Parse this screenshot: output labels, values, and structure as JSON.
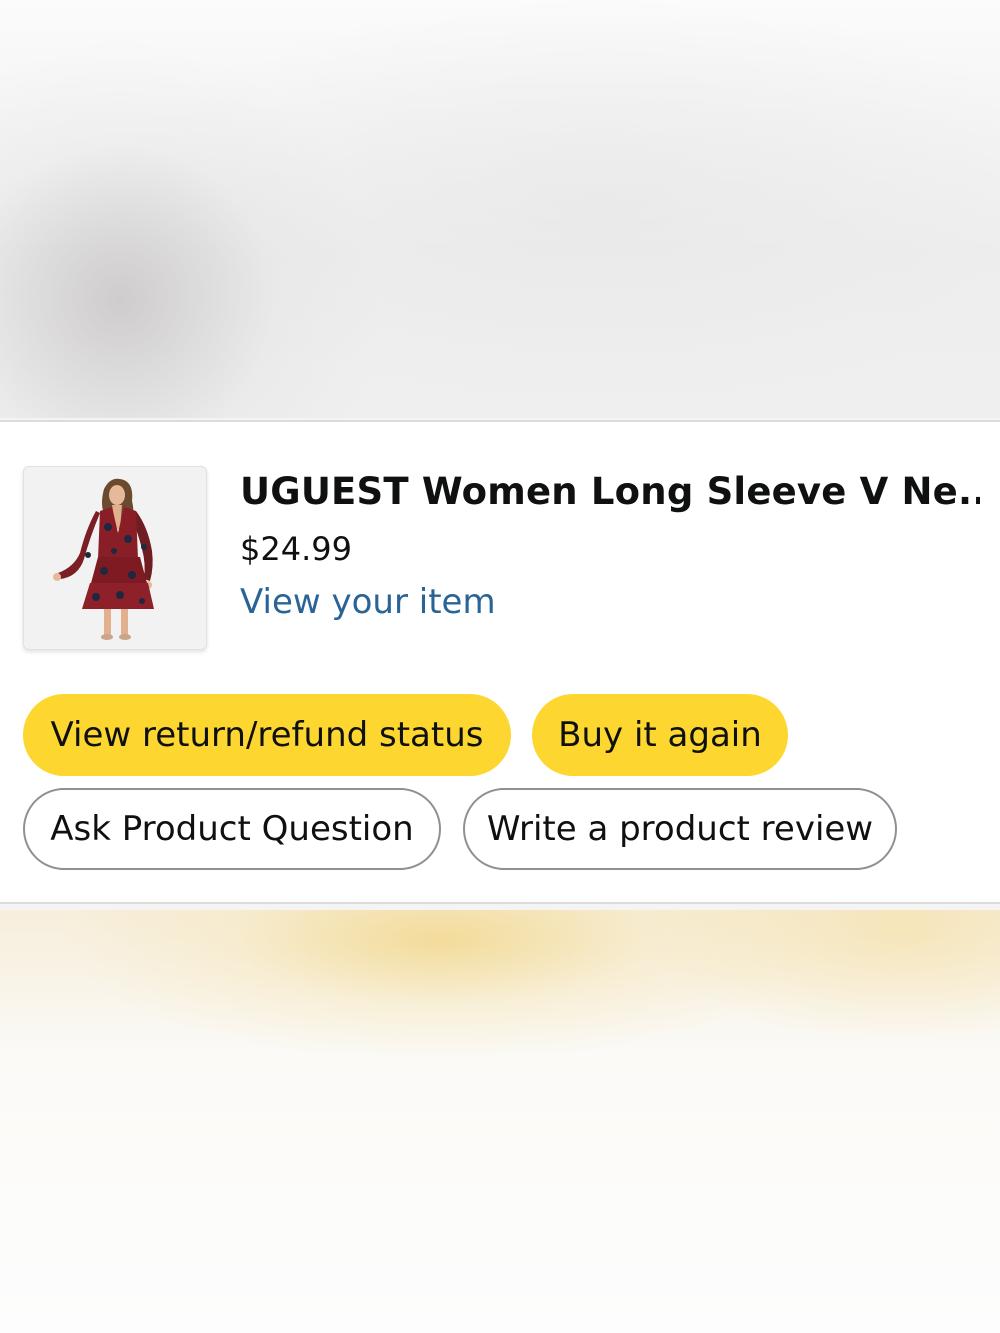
{
  "product": {
    "title": "UGUEST Women Long Sleeve V Ne...",
    "price": "$24.99",
    "view_link": "View your item",
    "image_icon": "dress-product-image"
  },
  "actions": {
    "return_status": "View return/refund status",
    "buy_again": "Buy it again",
    "ask_question": "Ask Product Question",
    "write_review": "Write a product review"
  },
  "colors": {
    "primary_button": "#fed630",
    "link": "#2a6496",
    "text": "#0f1111",
    "outline": "#8d9096"
  }
}
